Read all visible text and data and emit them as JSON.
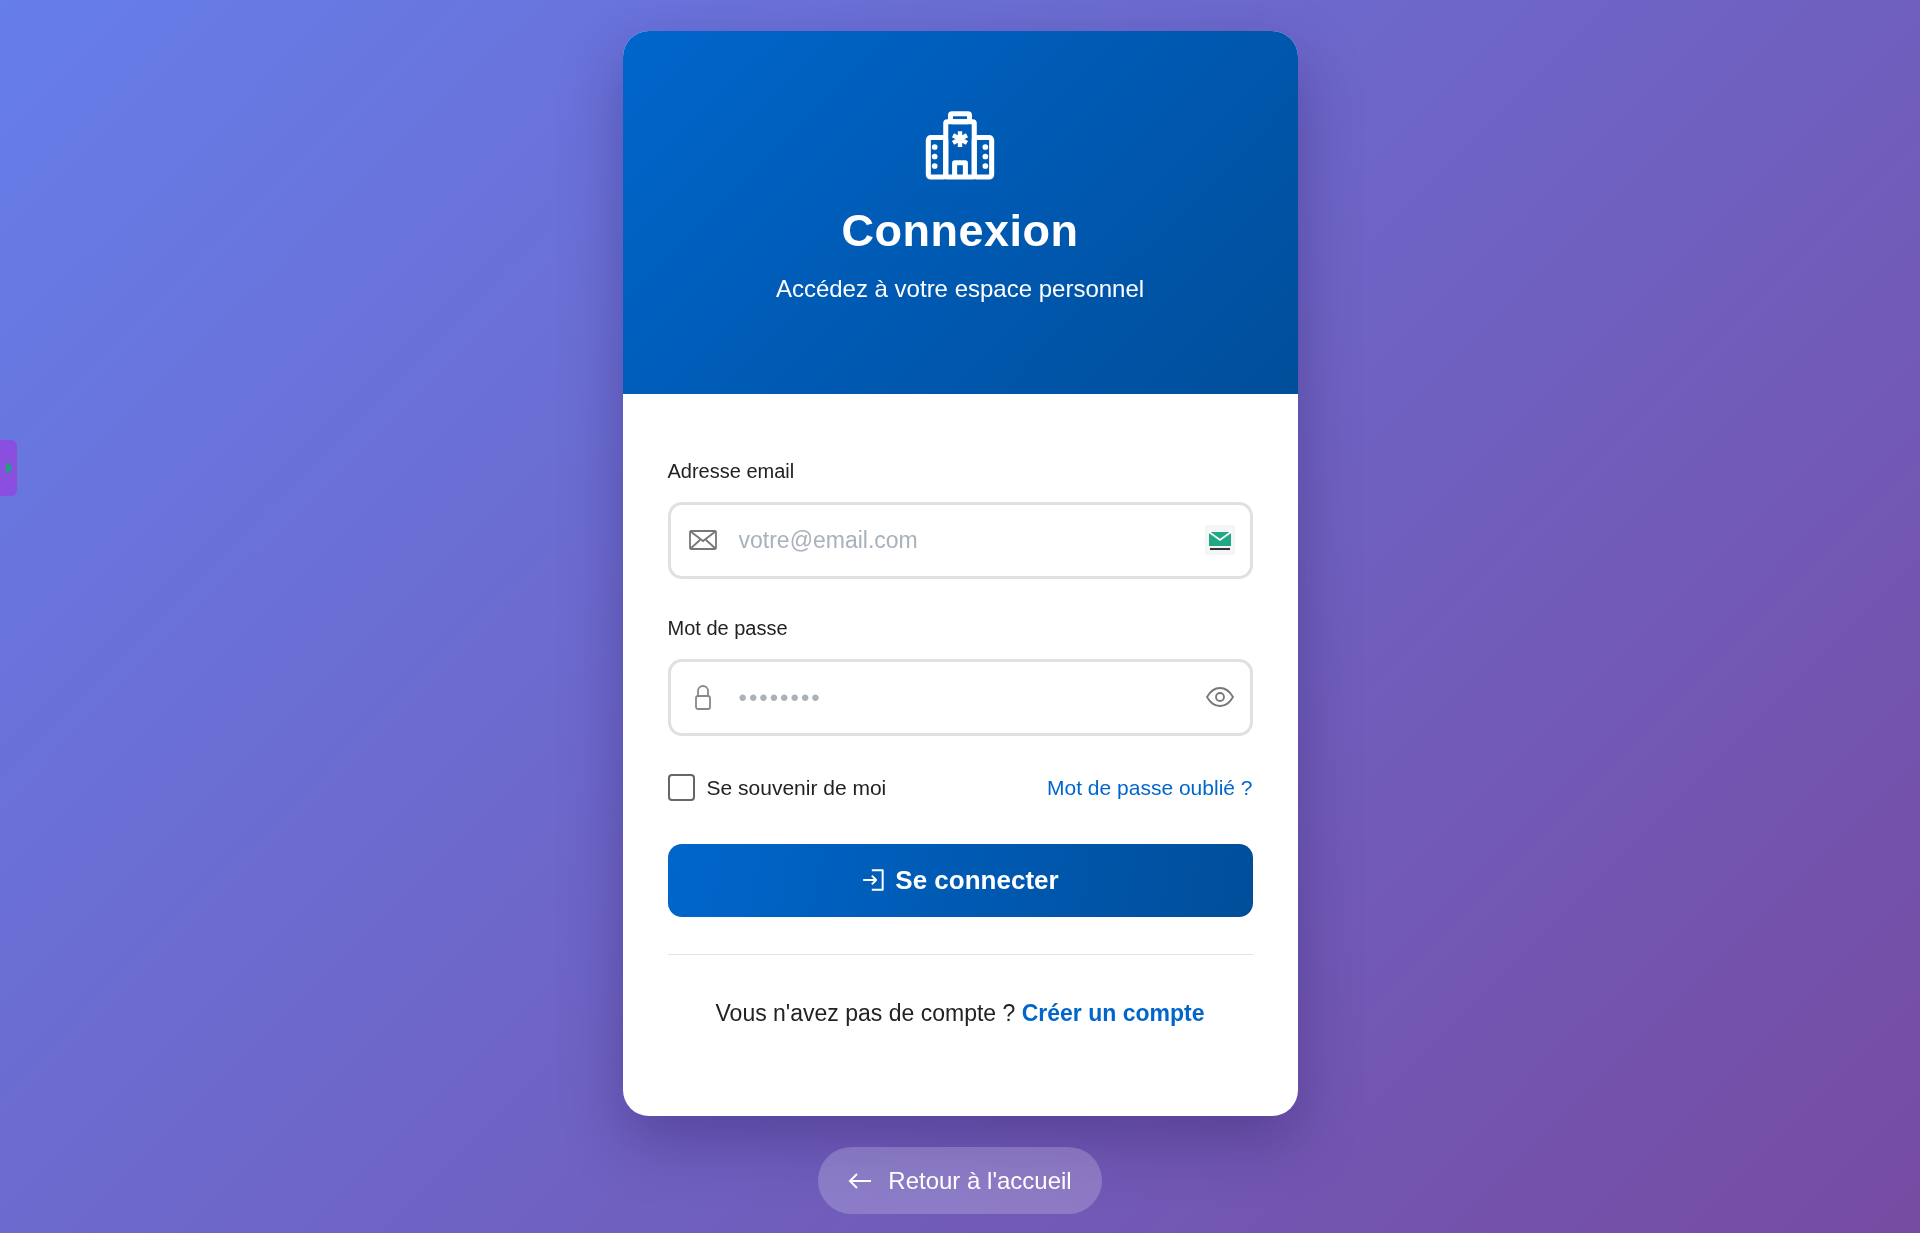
{
  "header": {
    "title": "Connexion",
    "subtitle": "Accédez à votre espace personnel"
  },
  "email": {
    "label": "Adresse email",
    "placeholder": "votre@email.com"
  },
  "password": {
    "label": "Mot de passe",
    "value": "••••••••"
  },
  "remember": {
    "label": "Se souvenir de moi",
    "checked": false
  },
  "forgot_link": "Mot de passe oublié ?",
  "submit_button": "Se connecter",
  "signup": {
    "text": "Vous n'avez pas de compte ?",
    "link": "Créer un compte"
  },
  "back_button": "Retour à l'accueil"
}
